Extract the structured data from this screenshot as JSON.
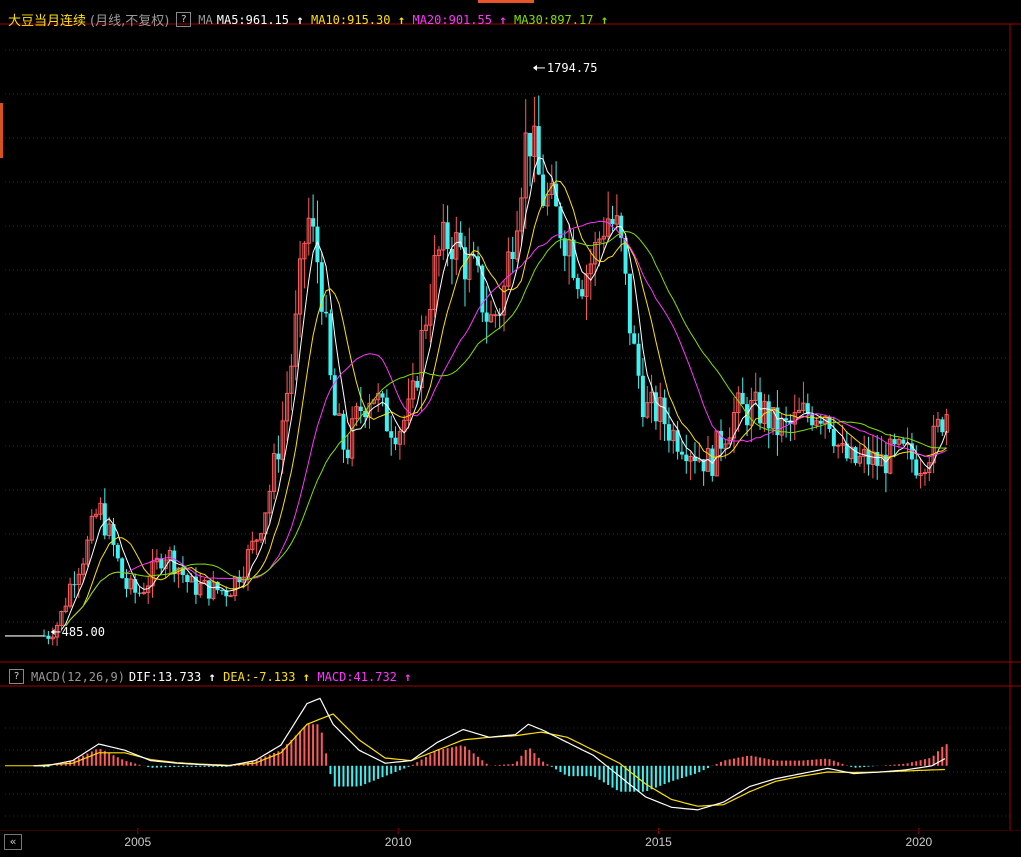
{
  "header": {
    "symbol": "大豆当月连续",
    "subtitle": "(月线,不复权)",
    "help_icon": "question-mark-icon",
    "ma_label": "MA",
    "ma_items": [
      {
        "text": "MA5:961.15",
        "color": "#ffffff"
      },
      {
        "text": "MA10:915.30",
        "color": "#ffe000"
      },
      {
        "text": "MA20:901.55",
        "color": "#ff33ff"
      },
      {
        "text": "MA30:897.17",
        "color": "#7fe000"
      }
    ]
  },
  "macd_header": {
    "label": "MACD(12,26,9)",
    "items": [
      {
        "text": "DIF:13.733",
        "color": "#ffffff"
      },
      {
        "text": "DEA:-7.133",
        "color": "#ffe000"
      },
      {
        "text": "MACD:41.732",
        "color": "#ff33ff"
      }
    ]
  },
  "colors": {
    "up": "#ff5a5a",
    "down": "#3ff0f0",
    "grid": "#8b0000",
    "frame": "#a00000",
    "text": "#cccccc"
  },
  "chart_data": [
    {
      "type": "candlestick",
      "title": "大豆当月连续",
      "annotations": [
        {
          "text": "1794.75",
          "x": 2012.55,
          "y": 1794.75
        },
        {
          "text": "485.00",
          "x": 2003.25,
          "y": 485.0
        }
      ],
      "x_ticks": [
        "2005",
        "2010",
        "2015",
        "2020"
      ],
      "ylim": [
        430,
        1870
      ],
      "close": [
        [
          2002.5,
          490
        ],
        [
          2003.0,
          490
        ],
        [
          2003.25,
          485
        ],
        [
          2003.5,
          520
        ],
        [
          2003.75,
          620
        ],
        [
          2004.0,
          680
        ],
        [
          2004.25,
          780
        ],
        [
          2004.5,
          700
        ],
        [
          2004.75,
          600
        ],
        [
          2005.0,
          580
        ],
        [
          2005.25,
          620
        ],
        [
          2005.5,
          680
        ],
        [
          2005.75,
          650
        ],
        [
          2006.0,
          600
        ],
        [
          2006.25,
          595
        ],
        [
          2006.5,
          590
        ],
        [
          2006.75,
          590
        ],
        [
          2007.0,
          640
        ],
        [
          2007.25,
          700
        ],
        [
          2007.5,
          800
        ],
        [
          2007.75,
          950
        ],
        [
          2008.0,
          1150
        ],
        [
          2008.25,
          1450
        ],
        [
          2008.5,
          1320
        ],
        [
          2008.75,
          1000
        ],
        [
          2009.0,
          900
        ],
        [
          2009.25,
          1000
        ],
        [
          2009.5,
          1050
        ],
        [
          2009.75,
          980
        ],
        [
          2010.0,
          960
        ],
        [
          2010.25,
          1000
        ],
        [
          2010.5,
          1200
        ],
        [
          2010.75,
          1350
        ],
        [
          2011.0,
          1400
        ],
        [
          2011.25,
          1350
        ],
        [
          2011.5,
          1300
        ],
        [
          2011.75,
          1200
        ],
        [
          2012.0,
          1250
        ],
        [
          2012.25,
          1450
        ],
        [
          2012.5,
          1650
        ],
        [
          2012.75,
          1500
        ],
        [
          2013.0,
          1450
        ],
        [
          2013.25,
          1400
        ],
        [
          2013.5,
          1300
        ],
        [
          2013.75,
          1350
        ],
        [
          2014.0,
          1450
        ],
        [
          2014.25,
          1400
        ],
        [
          2014.5,
          1150
        ],
        [
          2014.75,
          1000
        ],
        [
          2015.0,
          1000
        ],
        [
          2015.25,
          950
        ],
        [
          2015.5,
          930
        ],
        [
          2015.75,
          900
        ],
        [
          2016.0,
          880
        ],
        [
          2016.25,
          950
        ],
        [
          2016.5,
          1000
        ],
        [
          2016.75,
          1000
        ],
        [
          2017.0,
          1000
        ],
        [
          2017.25,
          960
        ],
        [
          2017.5,
          960
        ],
        [
          2017.75,
          990
        ],
        [
          2018.0,
          1000
        ],
        [
          2018.25,
          1000
        ],
        [
          2018.5,
          900
        ],
        [
          2018.75,
          880
        ],
        [
          2019.0,
          890
        ],
        [
          2019.25,
          880
        ],
        [
          2019.5,
          900
        ],
        [
          2019.75,
          900
        ],
        [
          2020.0,
          880
        ],
        [
          2020.25,
          920
        ],
        [
          2020.5,
          1000
        ]
      ],
      "ma_series": [
        {
          "name": "MA5",
          "color": "#ffffff",
          "period": 5
        },
        {
          "name": "MA10",
          "color": "#ffe000",
          "period": 10
        },
        {
          "name": "MA20",
          "color": "#ff33ff",
          "period": 20
        },
        {
          "name": "MA30",
          "color": "#7fe000",
          "period": 30
        }
      ]
    },
    {
      "type": "bar",
      "title": "MACD(12,26,9)",
      "dif": [
        [
          2003.0,
          0
        ],
        [
          2003.25,
          0
        ],
        [
          2003.75,
          10
        ],
        [
          2004.25,
          42
        ],
        [
          2004.75,
          30
        ],
        [
          2005.25,
          10
        ],
        [
          2005.75,
          5
        ],
        [
          2006.25,
          2
        ],
        [
          2006.75,
          0
        ],
        [
          2007.25,
          10
        ],
        [
          2007.75,
          40
        ],
        [
          2008.25,
          120
        ],
        [
          2008.5,
          130
        ],
        [
          2008.75,
          80
        ],
        [
          2009.25,
          30
        ],
        [
          2009.75,
          5
        ],
        [
          2010.25,
          10
        ],
        [
          2010.75,
          45
        ],
        [
          2011.25,
          70
        ],
        [
          2011.75,
          55
        ],
        [
          2012.25,
          60
        ],
        [
          2012.5,
          80
        ],
        [
          2012.75,
          70
        ],
        [
          2013.25,
          45
        ],
        [
          2013.75,
          20
        ],
        [
          2014.25,
          -20
        ],
        [
          2014.75,
          -60
        ],
        [
          2015.25,
          -80
        ],
        [
          2015.75,
          -85
        ],
        [
          2016.25,
          -70
        ],
        [
          2016.75,
          -40
        ],
        [
          2017.25,
          -25
        ],
        [
          2017.75,
          -15
        ],
        [
          2018.25,
          -5
        ],
        [
          2018.75,
          -15
        ],
        [
          2019.25,
          -12
        ],
        [
          2019.75,
          -8
        ],
        [
          2020.25,
          0
        ],
        [
          2020.5,
          13.733
        ]
      ],
      "dea": [
        [
          2003.0,
          0
        ],
        [
          2003.75,
          5
        ],
        [
          2004.25,
          25
        ],
        [
          2004.75,
          25
        ],
        [
          2005.25,
          12
        ],
        [
          2005.75,
          6
        ],
        [
          2006.25,
          3
        ],
        [
          2006.75,
          1
        ],
        [
          2007.25,
          5
        ],
        [
          2007.75,
          25
        ],
        [
          2008.25,
          80
        ],
        [
          2008.75,
          100
        ],
        [
          2009.25,
          50
        ],
        [
          2009.75,
          15
        ],
        [
          2010.25,
          10
        ],
        [
          2010.75,
          30
        ],
        [
          2011.25,
          50
        ],
        [
          2011.75,
          55
        ],
        [
          2012.25,
          58
        ],
        [
          2012.75,
          65
        ],
        [
          2013.25,
          55
        ],
        [
          2013.75,
          30
        ],
        [
          2014.25,
          5
        ],
        [
          2014.75,
          -35
        ],
        [
          2015.25,
          -65
        ],
        [
          2015.75,
          -78
        ],
        [
          2016.25,
          -75
        ],
        [
          2016.75,
          -50
        ],
        [
          2017.25,
          -30
        ],
        [
          2017.75,
          -20
        ],
        [
          2018.25,
          -12
        ],
        [
          2018.75,
          -13
        ],
        [
          2019.25,
          -12
        ],
        [
          2019.75,
          -10
        ],
        [
          2020.25,
          -8
        ],
        [
          2020.5,
          -7.133
        ]
      ],
      "hist_latest": 41.732,
      "ylim": [
        -120,
        150
      ]
    }
  ]
}
